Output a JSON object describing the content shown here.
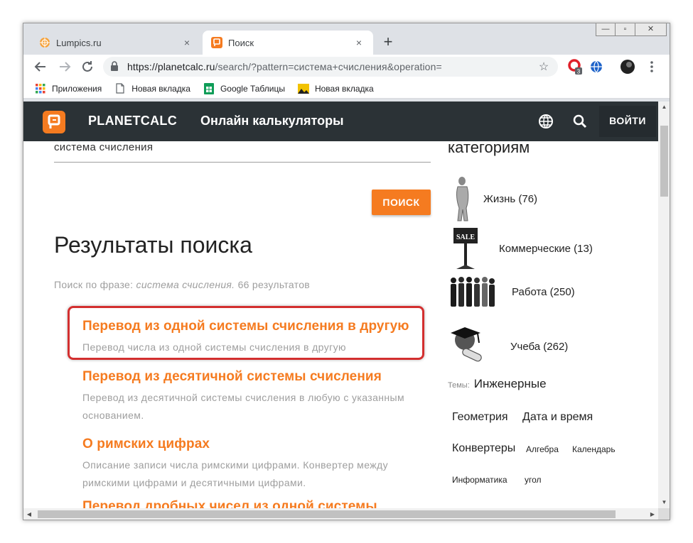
{
  "browser": {
    "tabs": [
      {
        "title": "Lumpics.ru",
        "active": false
      },
      {
        "title": "Поиск",
        "active": true
      }
    ],
    "new_tab_label": "+",
    "close_label": "×",
    "window_buttons": {
      "minimize": "—",
      "maximize": "▫",
      "close": "✕"
    },
    "url_host": "https://planetcalc.ru",
    "url_rest": "/search/?pattern=система+счисления&operation=",
    "extension_badge": "3",
    "bookmarks": [
      {
        "label": "Приложения",
        "icon": "apps-grid-icon"
      },
      {
        "label": "Новая вкладка",
        "icon": "page-icon"
      },
      {
        "label": "Google Таблицы",
        "icon": "sheets-icon"
      },
      {
        "label": "Новая вкладка",
        "icon": "image-icon"
      }
    ]
  },
  "site": {
    "brand": "PLANETCALC",
    "tagline": "Онлайн калькуляторы",
    "login_label": "ВОЙТИ",
    "accent_color": "#f57b20",
    "header_color": "#2b3236"
  },
  "search": {
    "value": "система счисления",
    "button_label": "ПОИСК"
  },
  "results": {
    "title": "Результаты поиска",
    "info_prefix": "Поиск по фразе: ",
    "info_phrase": "система счисления.",
    "info_suffix": " 66 результатов",
    "items": [
      {
        "title": "Перевод из одной системы счисления в другую",
        "desc": "Перевод числа из одной системы счисления в другую"
      },
      {
        "title": "Перевод из десятичной системы счисления",
        "desc": "Перевод из десятичной системы счисления в любую с указанным основанием."
      },
      {
        "title": "О римских цифрах",
        "desc": "Описание записи числа римскими цифрами. Конвертер между римскими цифрами и десятичными цифрами."
      },
      {
        "title": "Перевод дробных чисел из одной системы",
        "desc": ""
      }
    ]
  },
  "sidebar": {
    "title": "категориям",
    "categories": [
      {
        "label": "Жизнь (76)"
      },
      {
        "label": "Коммерческие (13)"
      },
      {
        "label": "Работа (250)"
      },
      {
        "label": "Учеба (262)"
      }
    ],
    "sale_sign": "SALE",
    "topics_label": "Темы:",
    "topics_first": "Инженерные",
    "tags": [
      "Геометрия",
      "Дата и время",
      "Конвертеры",
      "Алгебра",
      "Календарь",
      "Информатика",
      "угол"
    ]
  }
}
